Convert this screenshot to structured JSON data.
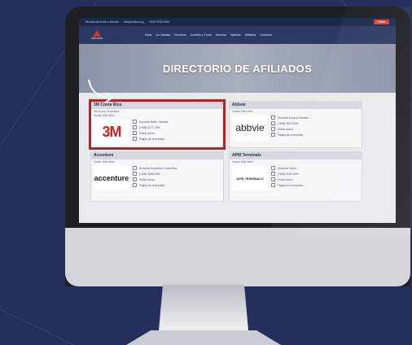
{
  "site": {
    "topbar_text": [
      "Horario de lunes a viernes",
      "info@anfacr.org",
      "+506 2234-5454"
    ],
    "topbar_button": "Afíliate",
    "brand": "AMCHAM",
    "nav": [
      "Inicio",
      "La Cámara",
      "Servicios",
      "Comités y Foros",
      "Eventos",
      "Noticias",
      "Afiliados",
      "Contacto"
    ],
    "hero_title": "DIRECTORIO DE AFILIADOS"
  },
  "cards": [
    {
      "name": "3M Costa Rica",
      "sub1": "Servicios Generales",
      "sub2": "Visitar Sitio Web",
      "logo": "3M",
      "rows": [
        "Dirección Belén, Heredia",
        "(+506) 2277-1000",
        "Enviar correo",
        "Página de la empresa"
      ]
    },
    {
      "name": "Abbvie",
      "sub1": "Visitar Sitio Web",
      "sub2": "",
      "logo": "abbvie",
      "rows": [
        "Dirección Escazú, Heredia",
        "(+506) 2507-2900",
        "Enviar correo",
        "Página de la empresa"
      ]
    },
    {
      "name": "Accenture",
      "sub1": "Visitar Sitio Web",
      "sub2": "",
      "logo": "accenture",
      "rows": [
        "Dirección Santa Ana, Costa Rica",
        "(+506) 2505-0000",
        "Enviar correo",
        "Página de la empresa"
      ]
    },
    {
      "name": "APM Terminals",
      "sub1": "Visitar Sitio Web",
      "sub2": "",
      "logo": "APM TERMINALS",
      "rows": [
        "Dirección Limón",
        "(+506) 2100-4000",
        "Enviar correo",
        "Página de la empresa"
      ]
    }
  ],
  "colors": {
    "accent": "#b3232a",
    "navy": "#2b3a62",
    "background": "#242f5c"
  }
}
